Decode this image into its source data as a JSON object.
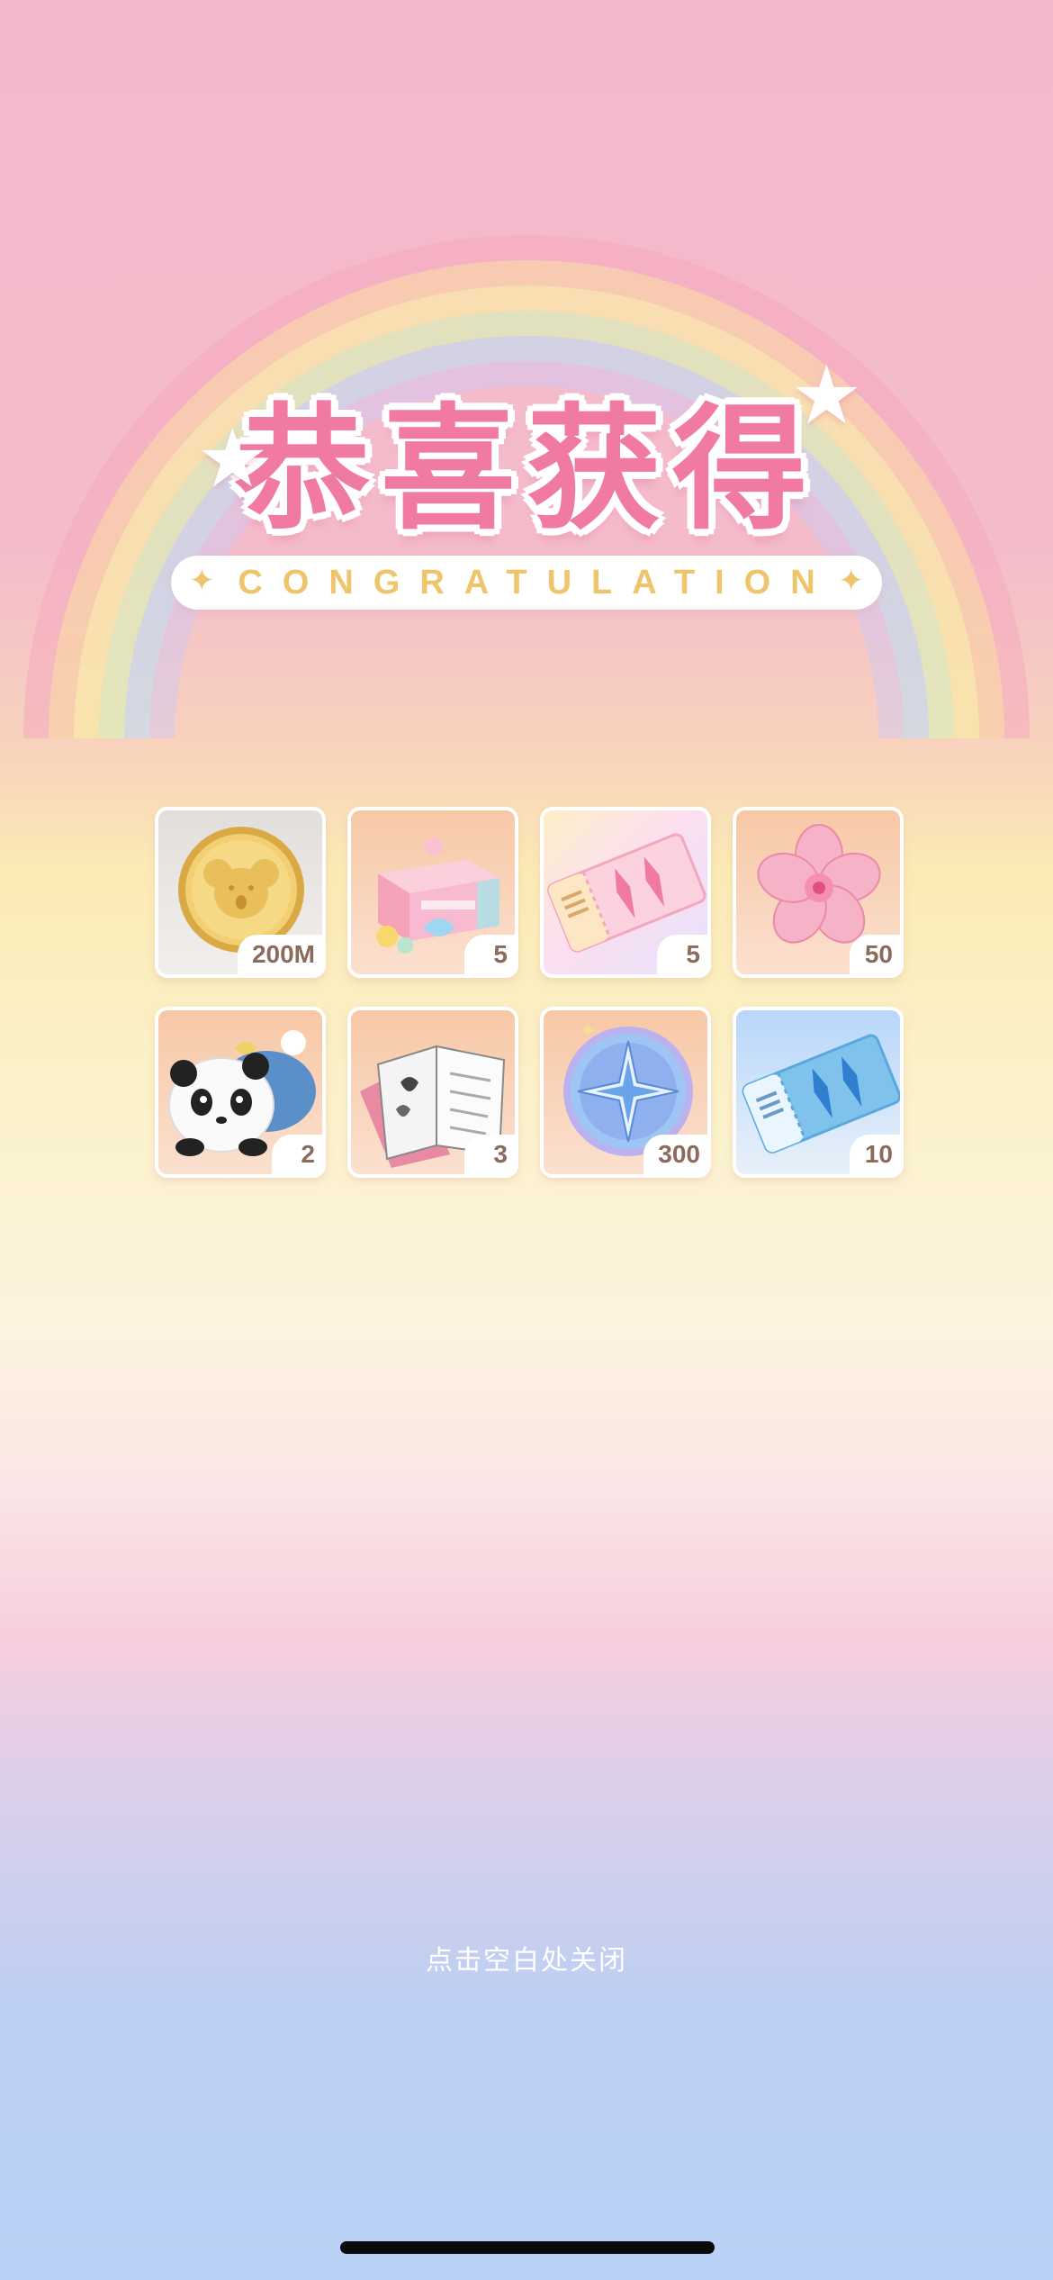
{
  "header": {
    "title_cn": "恭喜获得",
    "subtitle": "CONGRATULATION"
  },
  "rewards": [
    {
      "name": "koala-gold-coin",
      "quantity": "200M"
    },
    {
      "name": "gift-box",
      "quantity": "5"
    },
    {
      "name": "pink-ticket",
      "quantity": "5"
    },
    {
      "name": "sakura-flower",
      "quantity": "50"
    },
    {
      "name": "panda-plush",
      "quantity": "2"
    },
    {
      "name": "open-book",
      "quantity": "3"
    },
    {
      "name": "star-compass-coin",
      "quantity": "300"
    },
    {
      "name": "blue-ticket",
      "quantity": "10"
    }
  ],
  "footer": {
    "close_hint": "点击空白处关闭"
  },
  "colors": {
    "title_pink": "#f07aa2",
    "banner_gold": "#eec56a",
    "qty_text": "#8a6b5c"
  }
}
